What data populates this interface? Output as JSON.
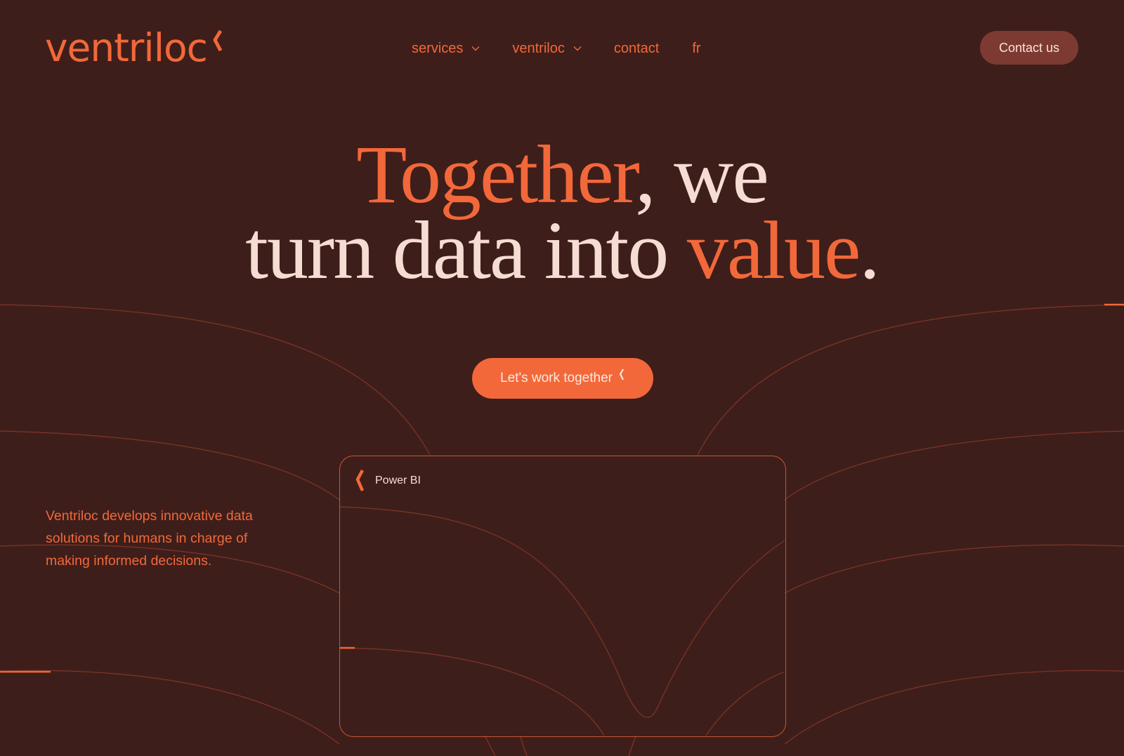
{
  "header": {
    "logo_text": "ventriloc",
    "nav": {
      "services": "services",
      "ventriloc": "ventriloc",
      "contact": "contact",
      "lang": "fr"
    },
    "contact_button": "Contact us"
  },
  "hero": {
    "line1_accent": "Together",
    "line1_rest": ", we",
    "line2_start": "turn data into ",
    "line2_accent": "value",
    "line2_end": ".",
    "cta_label": "Let's work together"
  },
  "tagline": "Ventriloc develops innovative data solutions for humans in charge of making informed decisions.",
  "card": {
    "title": "Power BI"
  },
  "colors": {
    "background": "#3e1e1a",
    "accent": "#f2683a",
    "light_text": "#f6ddd4",
    "button_dark": "#7d3a32"
  }
}
